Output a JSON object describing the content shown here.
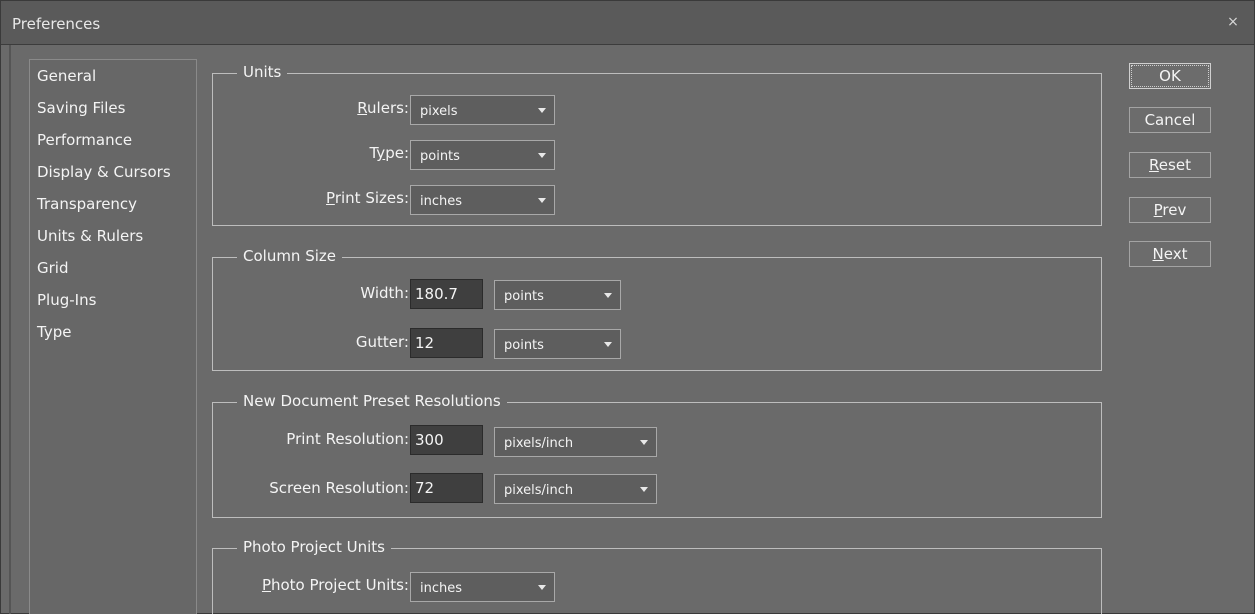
{
  "window": {
    "title": "Preferences",
    "close_glyph": "×"
  },
  "sidebar": {
    "items": [
      {
        "label": "General"
      },
      {
        "label": "Saving Files"
      },
      {
        "label": "Performance"
      },
      {
        "label": "Display & Cursors"
      },
      {
        "label": "Transparency"
      },
      {
        "label": "Units & Rulers"
      },
      {
        "label": "Grid"
      },
      {
        "label": "Plug-Ins"
      },
      {
        "label": "Type"
      }
    ]
  },
  "units": {
    "title": "Units",
    "rulers": {
      "label_u": "R",
      "label_rest": "ulers:",
      "value": "pixels"
    },
    "type": {
      "label_pre": "T",
      "label_u": "y",
      "label_rest": "pe:",
      "value": "points"
    },
    "print_sizes": {
      "label_u": "P",
      "label_rest": "rint Sizes:",
      "value": "inches"
    }
  },
  "column_size": {
    "title": "Column Size",
    "width": {
      "label": "Width:",
      "value": "180.7",
      "unit": "points"
    },
    "gutter": {
      "label": "Gutter:",
      "value": "12",
      "unit": "points"
    }
  },
  "new_doc": {
    "title": "New Document Preset Resolutions",
    "print_resolution": {
      "label": "Print Resolution:",
      "value": "300",
      "unit": "pixels/inch"
    },
    "screen_resolution": {
      "label": "Screen Resolution:",
      "value": "72",
      "unit": "pixels/inch"
    }
  },
  "photo_project": {
    "title": "Photo Project Units",
    "units": {
      "label_u": "P",
      "label_rest": "hoto Project Units:",
      "value": "inches"
    }
  },
  "buttons": {
    "ok": "OK",
    "cancel": "Cancel",
    "reset_u": "R",
    "reset_rest": "eset",
    "prev_u": "P",
    "prev_rest": "rev",
    "next_u": "N",
    "next_rest": "ext"
  },
  "colors": {
    "background": "#6a6a6a",
    "titlebar": "#5a5a5a",
    "input_bg": "#3f3f3f",
    "text": "#f4f4f4"
  }
}
